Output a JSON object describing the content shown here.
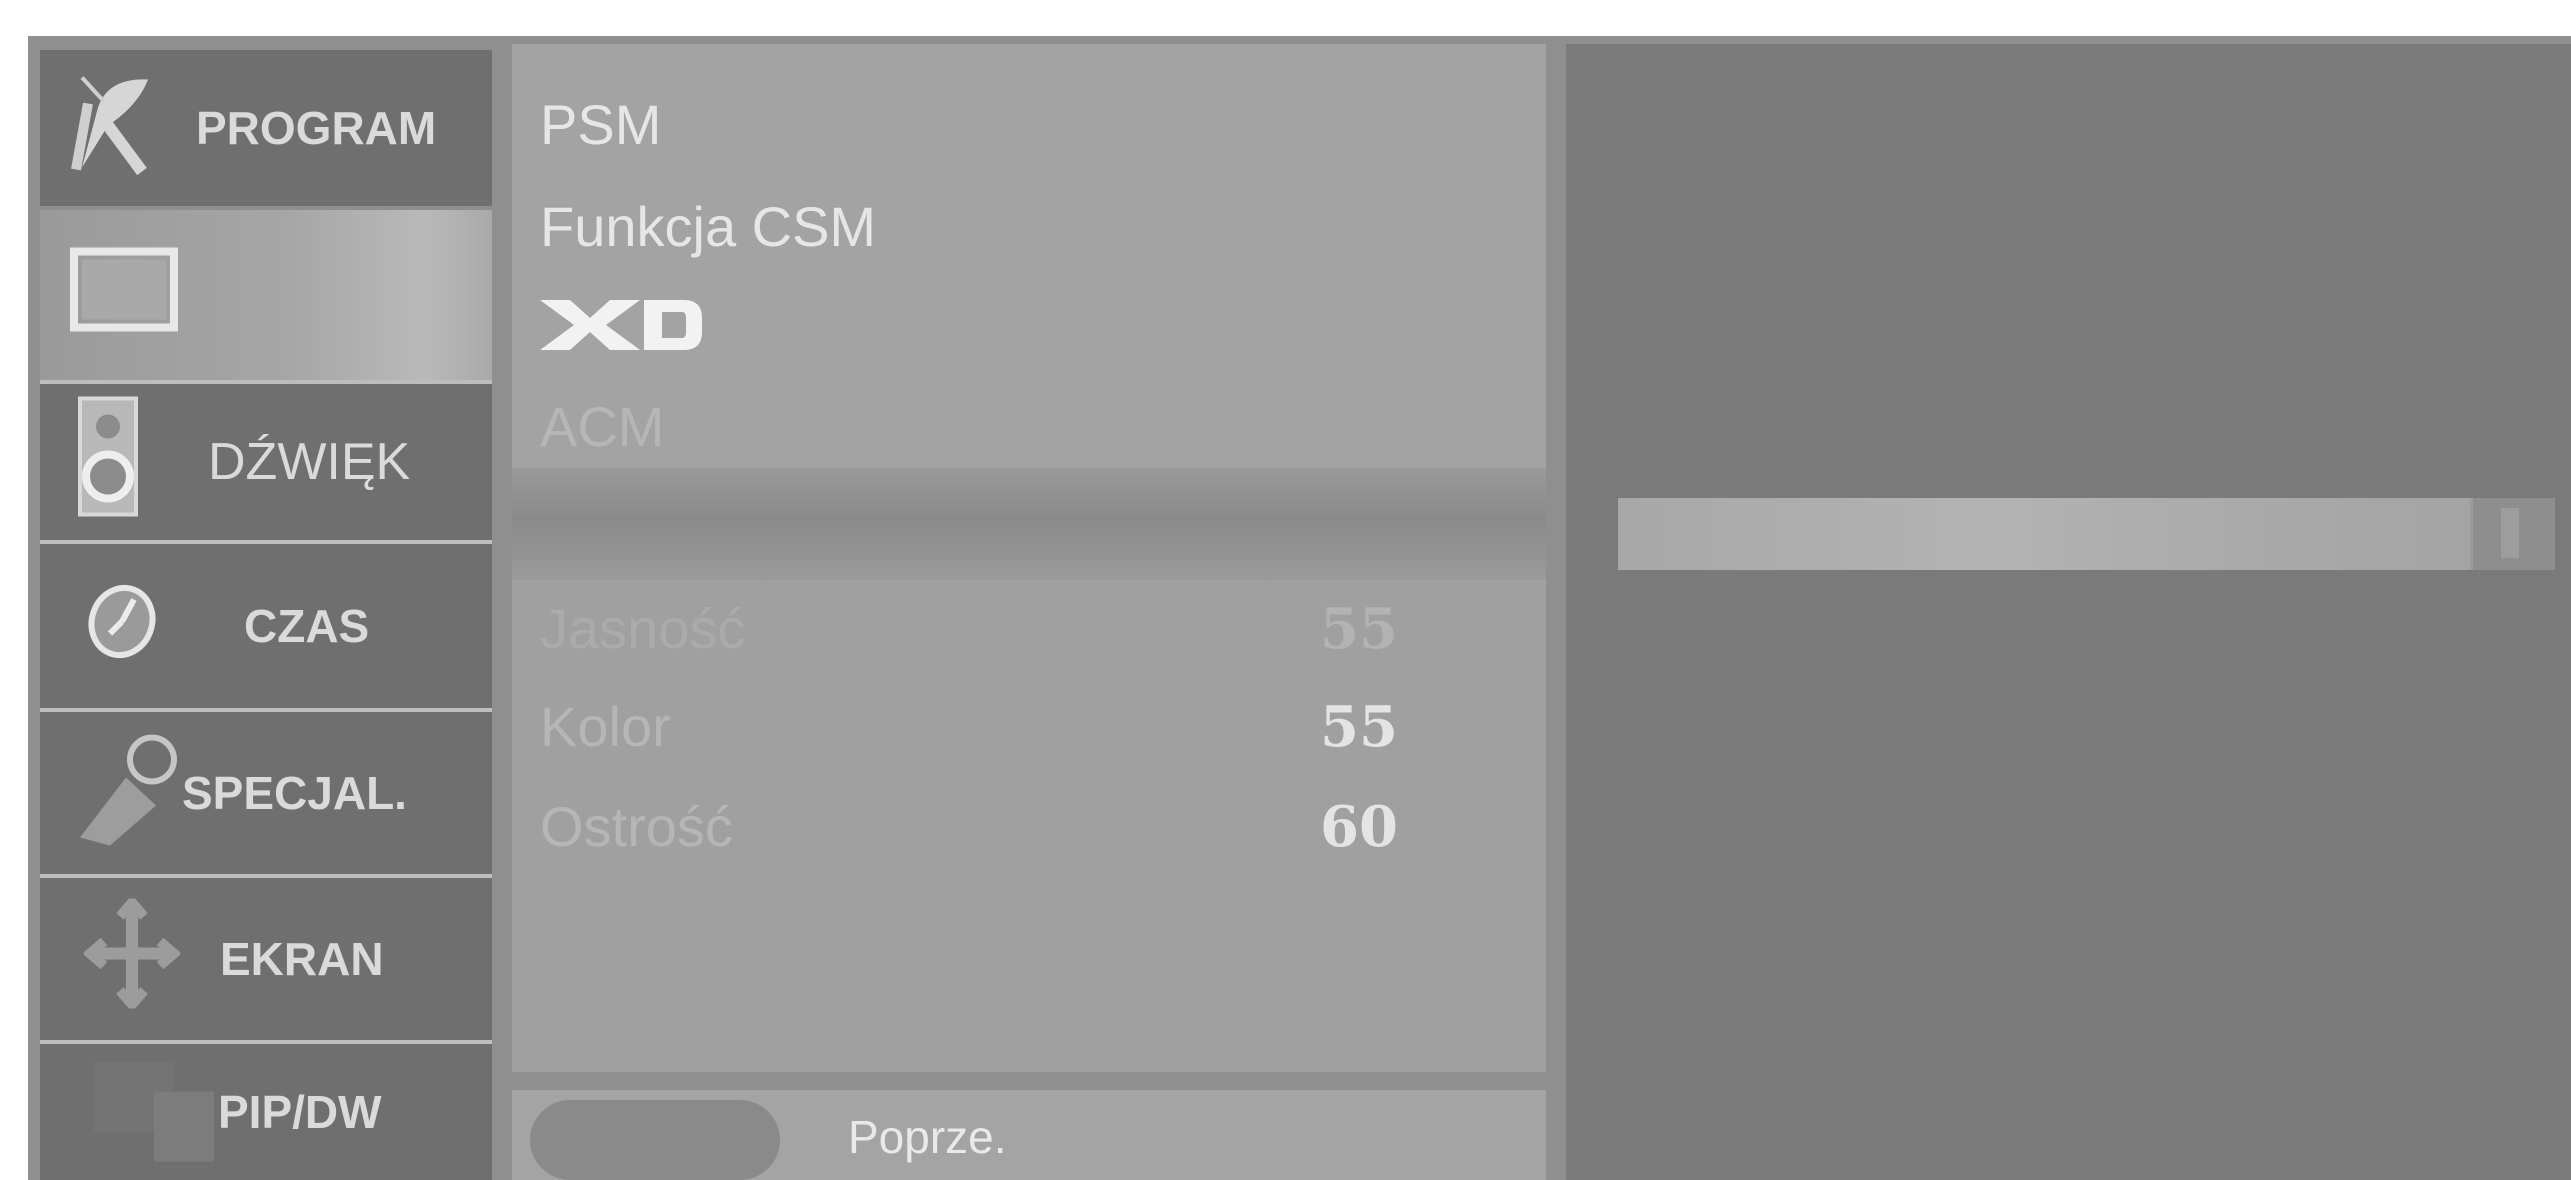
{
  "categories": [
    {
      "id": "program",
      "label": "PROGRAM",
      "icon": "satellite-icon"
    },
    {
      "id": "obraz",
      "label": "",
      "icon": "screen-icon",
      "active": true
    },
    {
      "id": "dzwiek",
      "label": "DŹWIĘK",
      "icon": "speaker-icon"
    },
    {
      "id": "czas",
      "label": "CZAS",
      "icon": "clock-icon"
    },
    {
      "id": "specjal",
      "label": "SPECJAL.",
      "icon": "key-icon"
    },
    {
      "id": "ekran",
      "label": "EKRAN",
      "icon": "move-arrows-icon"
    },
    {
      "id": "pipdw",
      "label": "PIP/DW",
      "icon": "pip-icon"
    }
  ],
  "submenu": {
    "items": [
      {
        "label": "PSM"
      },
      {
        "label": "Funkcja CSM"
      },
      {
        "label": "XD",
        "logo": true
      },
      {
        "label": "ACM"
      }
    ],
    "adjustments": [
      {
        "label": "Jasność",
        "value": "55"
      },
      {
        "label": "Kolor",
        "value": "55"
      },
      {
        "label": "Ostrość",
        "value": "60"
      }
    ]
  },
  "footer": {
    "back_label": "Poprze."
  },
  "slider": {
    "level": 0.92
  },
  "colors": {
    "panel": "#a3a3a3",
    "category": "#6f6f6f",
    "right": "#7a7a7a",
    "text": "#e6e6e6"
  }
}
